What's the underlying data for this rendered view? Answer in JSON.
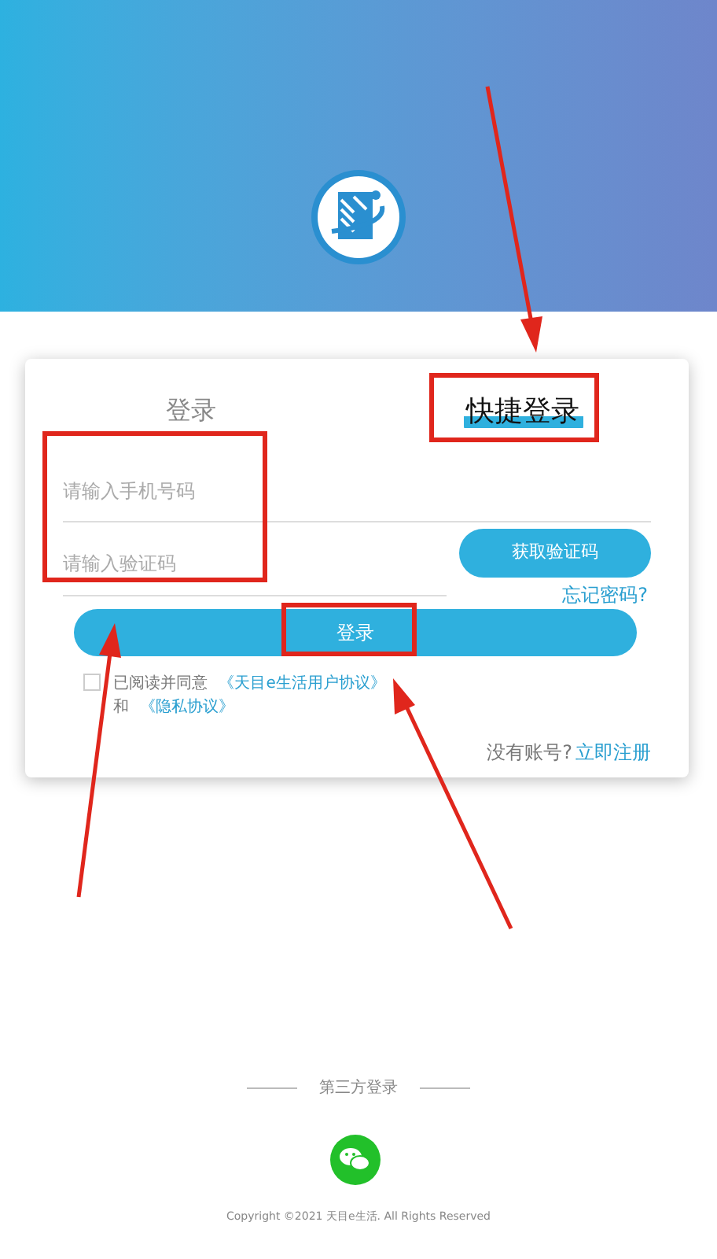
{
  "tabs": [
    {
      "label": "登录",
      "selected": false
    },
    {
      "label": "快捷登录",
      "selected": true
    }
  ],
  "phone_field": {
    "placeholder": "请输入手机号码"
  },
  "code_field": {
    "placeholder": "请输入验证码"
  },
  "get_code_button": "获取验证码",
  "forgot_password": "忘记密码?",
  "login_button": "登录",
  "agreement": {
    "checked": false,
    "prefix": "已阅读并同意",
    "user_agreement": "《天目e生活用户协议》",
    "and": "和",
    "privacy_policy": "《隐私协议》"
  },
  "register": {
    "prompt": "没有账号?",
    "link": "立即注册"
  },
  "third_party": {
    "title": "第三方登录"
  },
  "copyright": "Copyright ©2021 天目e生活. All Rights Reserved"
}
